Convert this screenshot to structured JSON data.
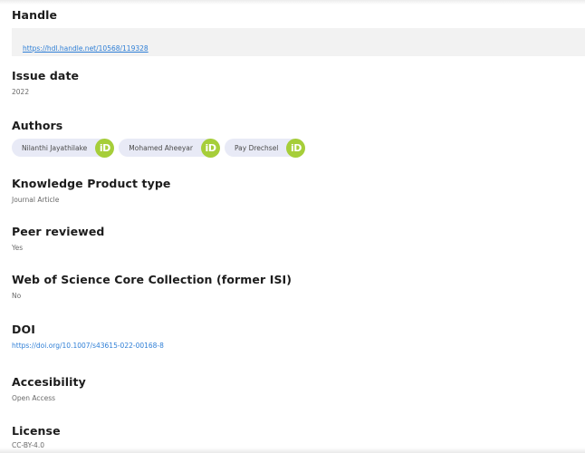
{
  "fields": {
    "handle": {
      "label": "Handle",
      "url": "https://hdl.handle.net/10568/119328"
    },
    "issue_date": {
      "label": "Issue date",
      "value": "2022"
    },
    "authors": {
      "label": "Authors",
      "items": [
        {
          "name": "Nilanthi Jayathilake",
          "badge": "iD"
        },
        {
          "name": "Mohamed Aheeyar",
          "badge": "iD"
        },
        {
          "name": "Pay Drechsel",
          "badge": "iD"
        }
      ]
    },
    "product_type": {
      "label": "Knowledge Product type",
      "value": "Journal Article"
    },
    "peer_reviewed": {
      "label": "Peer reviewed",
      "value": "Yes"
    },
    "wos": {
      "label": "Web of Science Core Collection (former ISI)",
      "value": "No"
    },
    "doi": {
      "label": "DOI",
      "url": "https://doi.org/10.1007/s43615-022-00168-8"
    },
    "accessibility": {
      "label": "Accesibility",
      "value": "Open Access"
    },
    "license": {
      "label": "License",
      "value": "CC-BY-4.0"
    }
  },
  "colors": {
    "link": "#2f7fd6",
    "orcid": "#a6ce39",
    "chip_bg": "#e8eaf6",
    "handle_bg": "#f2f2f2"
  }
}
